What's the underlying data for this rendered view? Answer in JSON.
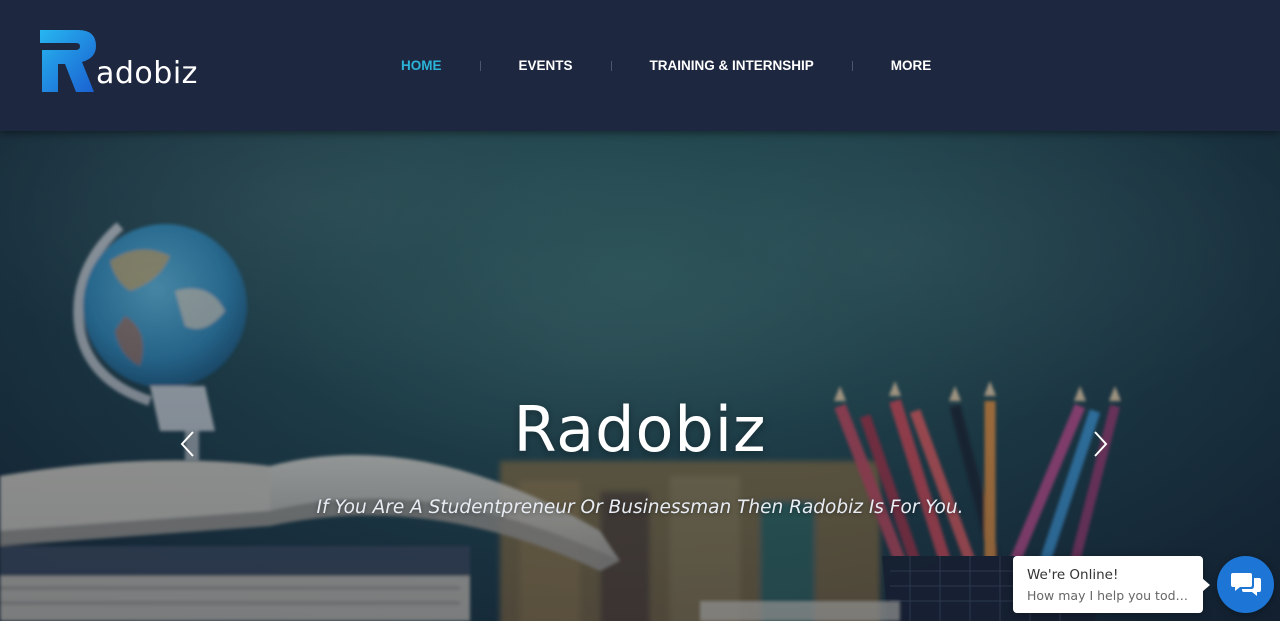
{
  "brand": {
    "logo_letter": "R",
    "name_rest": "adobiz",
    "accent_color": "#2bb4d8",
    "header_color": "#1e2740"
  },
  "nav": {
    "items": [
      {
        "label": "HOME",
        "active": true
      },
      {
        "label": "EVENTS",
        "active": false
      },
      {
        "label": "TRAINING & INTERNSHIP",
        "active": false
      },
      {
        "label": "MORE",
        "active": false
      }
    ]
  },
  "hero": {
    "title": "Radobiz",
    "subtitle": "If You Are A Studentpreneur Or Businessman Then Radobiz Is For You.",
    "prev_icon": "chevron-left-icon",
    "next_icon": "chevron-right-icon"
  },
  "chat": {
    "title": "We're Online!",
    "message": "How may I help you today?",
    "icon": "chat-icon",
    "button_color": "#1d75d6"
  }
}
